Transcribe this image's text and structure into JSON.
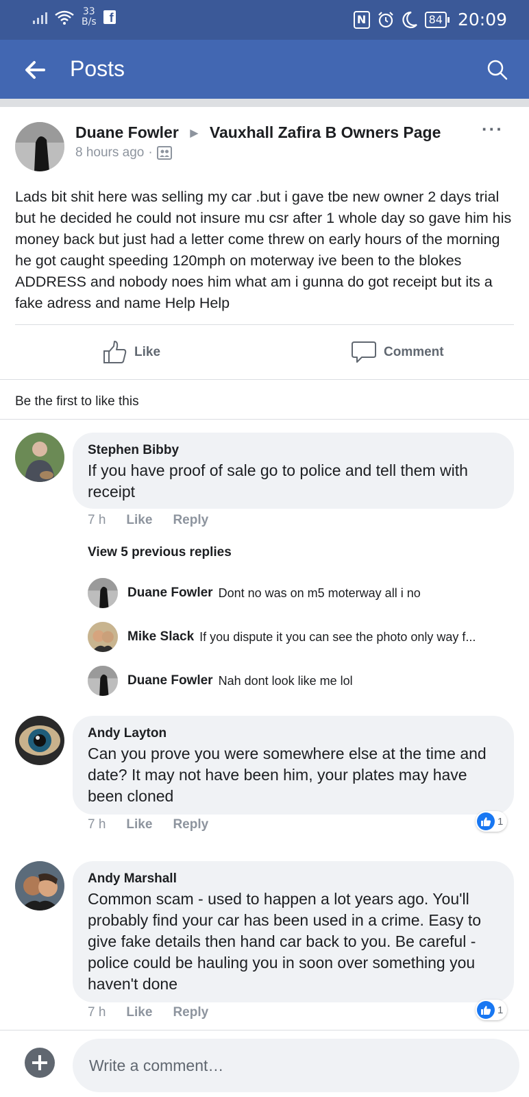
{
  "status_bar": {
    "speed_value": "33",
    "speed_unit": "B/s",
    "app_badge": "f",
    "nfc": "N",
    "battery": "84",
    "time": "20:09"
  },
  "header": {
    "title": "Posts",
    "back_icon": "arrow-left-icon",
    "search_icon": "search-icon"
  },
  "post": {
    "author": "Duane Fowler",
    "group": "Vauxhall Zafira B Owners Page",
    "time": "8 hours ago",
    "separator": "·",
    "privacy_icon": "group-icon",
    "more": "···",
    "body": "Lads bit shit here was selling my car .but i gave tbe new owner 2 days trial but he decided he could not insure mu csr after 1 whole day so gave him his money back but just had a letter come threw on early hours of the morning he got caught speeding 120mph on moterway ive been to the blokes ADDRESS and nobody noes him what am i gunna do got receipt but its a fake adress and name Help Help",
    "like_label": "Like",
    "comment_label": "Comment",
    "likes_summary": "Be the first to like this"
  },
  "comments": [
    {
      "name": "Stephen Bibby",
      "text": "If you have proof of sale go to police and tell them with receipt",
      "time": "7 h",
      "like": "Like",
      "reply": "Reply",
      "view_replies": "View 5 previous replies",
      "replies": [
        {
          "name": "Duane Fowler",
          "text": "Dont no was on m5 moterway all i no"
        },
        {
          "name": "Mike Slack",
          "text": "If you dispute it you can see the photo only way f..."
        },
        {
          "name": "Duane Fowler",
          "text": "Nah dont look like me lol"
        }
      ]
    },
    {
      "name": "Andy Layton",
      "text": "Can you prove you were somewhere else at the time and date? It may not have been him, your plates may have been cloned",
      "time": "7 h",
      "like": "Like",
      "reply": "Reply",
      "reactions": "1"
    },
    {
      "name": "Andy Marshall",
      "text": "Common scam - used to happen a lot years ago. You'll probably find your car has been used in a crime. Easy to give fake details then hand car back to you. Be careful - police could be hauling you in soon over something you haven't done",
      "time": "7 h",
      "like": "Like",
      "reply": "Reply",
      "reactions": "1"
    }
  ],
  "composer": {
    "placeholder": "Write a comment…",
    "add_icon": "plus-icon"
  },
  "colors": {
    "status_bar": "#3b5998",
    "header": "#4267b2",
    "bubble": "#f0f2f5",
    "reaction": "#1877f2"
  }
}
